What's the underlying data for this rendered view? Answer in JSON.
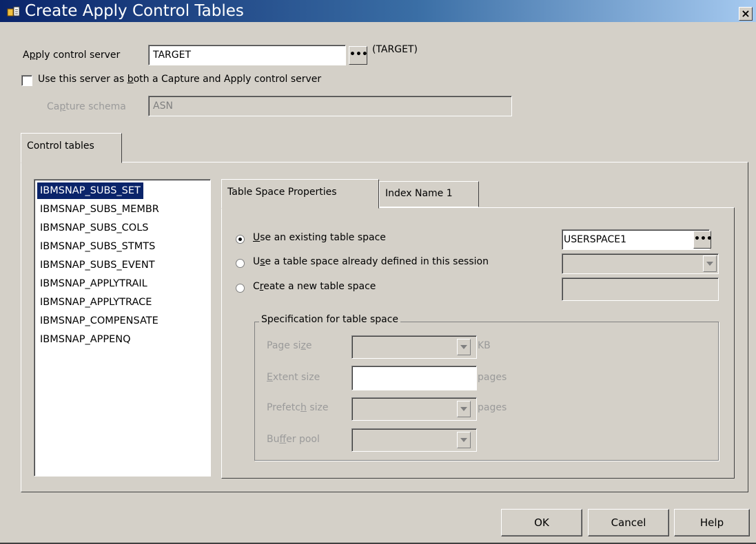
{
  "window": {
    "title": "Create Apply Control Tables",
    "close_symbol": "×"
  },
  "apply_server": {
    "label": "Apply control server",
    "value": "TARGET",
    "browse_label": "•••",
    "note": "(TARGET)"
  },
  "use_both": {
    "label": "Use this server as both a Capture and Apply control server",
    "checked": false
  },
  "capture_schema": {
    "label": "Capture schema",
    "value": "ASN"
  },
  "outer_tabs": [
    {
      "label": "Control tables",
      "selected": true
    }
  ],
  "control_tables": [
    {
      "name": "IBMSNAP_SUBS_SET",
      "selected": true
    },
    {
      "name": "IBMSNAP_SUBS_MEMBR",
      "selected": false
    },
    {
      "name": "IBMSNAP_SUBS_COLS",
      "selected": false
    },
    {
      "name": "IBMSNAP_SUBS_STMTS",
      "selected": false
    },
    {
      "name": "IBMSNAP_SUBS_EVENT",
      "selected": false
    },
    {
      "name": "IBMSNAP_APPLYTRAIL",
      "selected": false
    },
    {
      "name": "IBMSNAP_APPLYTRACE",
      "selected": false
    },
    {
      "name": "IBMSNAP_COMPENSATE",
      "selected": false
    },
    {
      "name": "IBMSNAP_APPENQ",
      "selected": false
    }
  ],
  "inner_tabs": [
    {
      "label": "Table Space Properties",
      "selected": true
    },
    {
      "label": "Index Name 1",
      "selected": false
    }
  ],
  "table_space_options": [
    {
      "label": "Use an existing table space",
      "selected": true,
      "value": "USERSPACE1",
      "browse_label": "•••"
    },
    {
      "label": "Use a table space already defined in this session",
      "selected": false,
      "value": ""
    },
    {
      "label": "Create a new table space",
      "selected": false,
      "value": ""
    }
  ],
  "specification": {
    "title": "Specification for table space",
    "page_size": {
      "label": "Page size",
      "unit": "KB"
    },
    "extent_size": {
      "label": "Extent size",
      "unit": "pages"
    },
    "prefetch_size": {
      "label": "Prefetch size",
      "unit": "pages"
    },
    "buffer_pool": {
      "label": "Buffer pool"
    }
  },
  "buttons": {
    "ok": "OK",
    "cancel": "Cancel",
    "help": "Help"
  },
  "colors": {
    "selection": "#0a246a",
    "face": "#d4d0c8",
    "title_start": "#0a246a",
    "title_end": "#a6caf0"
  }
}
